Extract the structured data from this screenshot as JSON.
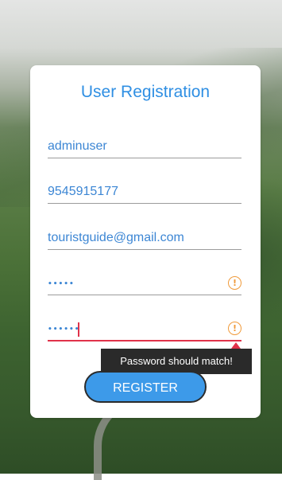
{
  "form": {
    "title": "User Registration",
    "username": "adminuser",
    "phone": "9545915177",
    "email": "touristguide@gmail.com",
    "password_masked": "•••••",
    "confirm_password_masked": "••••••",
    "register_label": "REGISTER"
  },
  "error": {
    "message": "Password should match!",
    "warning_glyph": "!"
  },
  "colors": {
    "accent": "#2f8fe3",
    "button": "#3d9ae9",
    "error": "#e0324a",
    "warning": "#f09a3a",
    "tooltip_bg": "#2a2a2a"
  }
}
